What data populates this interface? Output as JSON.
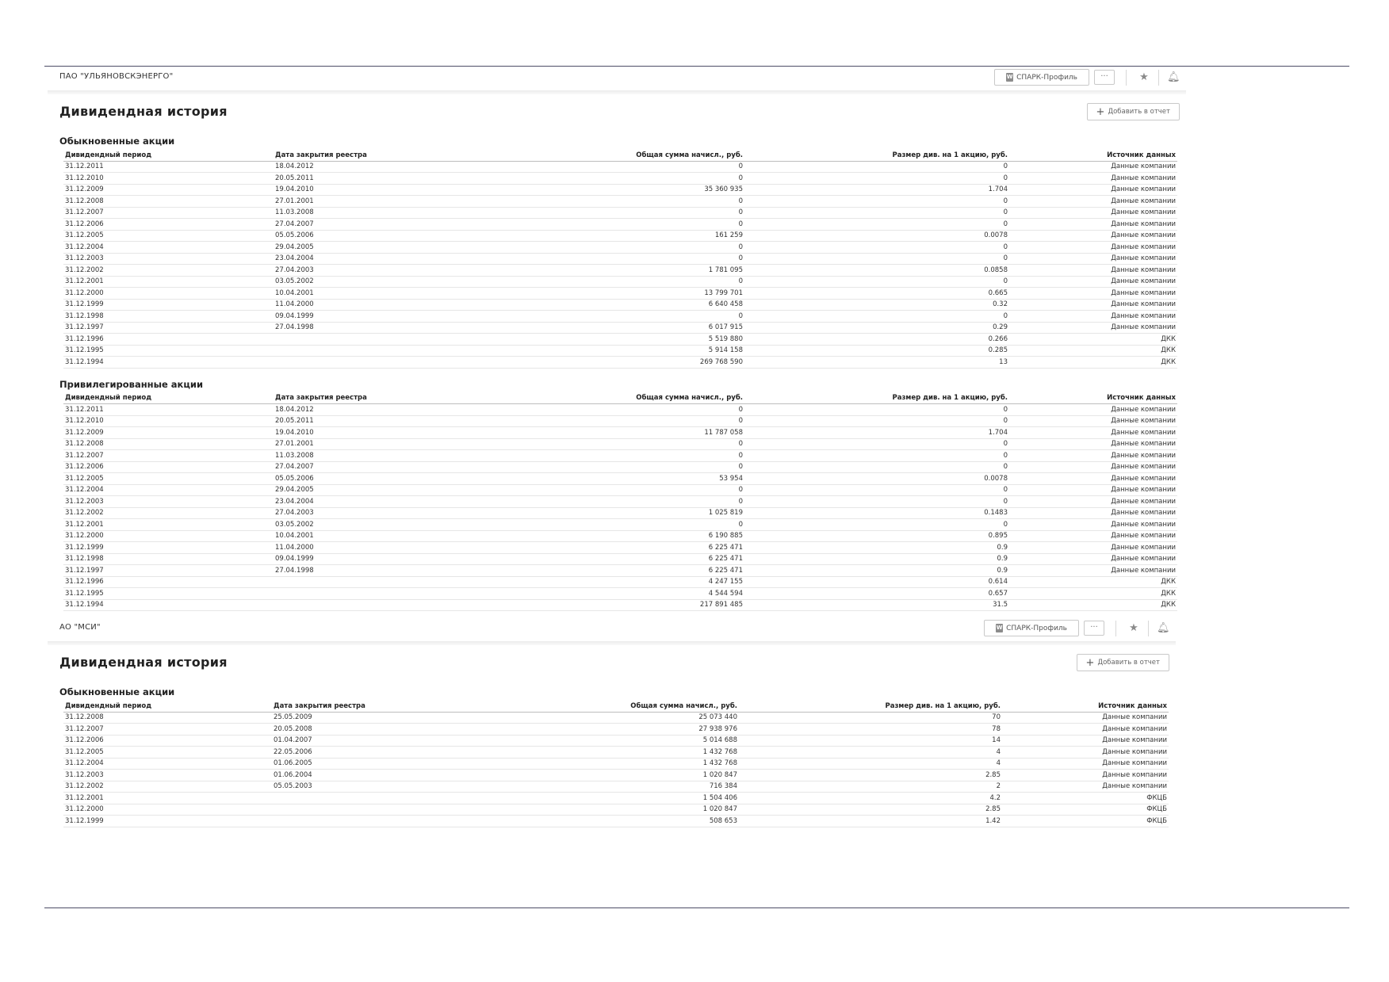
{
  "columns": {
    "period": "Дивидендный период",
    "record_date": "Дата закрытия реестра",
    "total": "Общая сумма начисл., руб.",
    "per_share": "Размер див. на 1 акцию, руб.",
    "source": "Источник данных"
  },
  "companies": [
    {
      "name": "ПАО \"УЛЬЯНОВСКЭНЕРГО\"",
      "spark_label": "СПАРК-Профиль",
      "more_label": "···",
      "section_title": "Дивидендная история",
      "add_label": "Добавить в отчет",
      "tables": [
        {
          "title": "Обыкновенные акции",
          "rows": [
            [
              "31.12.2011",
              "18.04.2012",
              "0",
              "0",
              "Данные компании"
            ],
            [
              "31.12.2010",
              "20.05.2011",
              "0",
              "0",
              "Данные компании"
            ],
            [
              "31.12.2009",
              "19.04.2010",
              "35 360 935",
              "1.704",
              "Данные компании"
            ],
            [
              "31.12.2008",
              "27.01.2001",
              "0",
              "0",
              "Данные компании"
            ],
            [
              "31.12.2007",
              "11.03.2008",
              "0",
              "0",
              "Данные компании"
            ],
            [
              "31.12.2006",
              "27.04.2007",
              "0",
              "0",
              "Данные компании"
            ],
            [
              "31.12.2005",
              "05.05.2006",
              "161 259",
              "0.0078",
              "Данные компании"
            ],
            [
              "31.12.2004",
              "29.04.2005",
              "0",
              "0",
              "Данные компании"
            ],
            [
              "31.12.2003",
              "23.04.2004",
              "0",
              "0",
              "Данные компании"
            ],
            [
              "31.12.2002",
              "27.04.2003",
              "1 781 095",
              "0.0858",
              "Данные компании"
            ],
            [
              "31.12.2001",
              "03.05.2002",
              "0",
              "0",
              "Данные компании"
            ],
            [
              "31.12.2000",
              "10.04.2001",
              "13 799 701",
              "0.665",
              "Данные компании"
            ],
            [
              "31.12.1999",
              "11.04.2000",
              "6 640 458",
              "0.32",
              "Данные компании"
            ],
            [
              "31.12.1998",
              "09.04.1999",
              "0",
              "0",
              "Данные компании"
            ],
            [
              "31.12.1997",
              "27.04.1998",
              "6 017 915",
              "0.29",
              "Данные компании"
            ],
            [
              "31.12.1996",
              "",
              "5 519 880",
              "0.266",
              "ДКК"
            ],
            [
              "31.12.1995",
              "",
              "5 914 158",
              "0.285",
              "ДКК"
            ],
            [
              "31.12.1994",
              "",
              "269 768 590",
              "13",
              "ДКК"
            ]
          ]
        },
        {
          "title": "Привилегированные акции",
          "rows": [
            [
              "31.12.2011",
              "18.04.2012",
              "0",
              "0",
              "Данные компании"
            ],
            [
              "31.12.2010",
              "20.05.2011",
              "0",
              "0",
              "Данные компании"
            ],
            [
              "31.12.2009",
              "19.04.2010",
              "11 787 058",
              "1.704",
              "Данные компании"
            ],
            [
              "31.12.2008",
              "27.01.2001",
              "0",
              "0",
              "Данные компании"
            ],
            [
              "31.12.2007",
              "11.03.2008",
              "0",
              "0",
              "Данные компании"
            ],
            [
              "31.12.2006",
              "27.04.2007",
              "0",
              "0",
              "Данные компании"
            ],
            [
              "31.12.2005",
              "05.05.2006",
              "53 954",
              "0.0078",
              "Данные компании"
            ],
            [
              "31.12.2004",
              "29.04.2005",
              "0",
              "0",
              "Данные компании"
            ],
            [
              "31.12.2003",
              "23.04.2004",
              "0",
              "0",
              "Данные компании"
            ],
            [
              "31.12.2002",
              "27.04.2003",
              "1 025 819",
              "0.1483",
              "Данные компании"
            ],
            [
              "31.12.2001",
              "03.05.2002",
              "0",
              "0",
              "Данные компании"
            ],
            [
              "31.12.2000",
              "10.04.2001",
              "6 190 885",
              "0.895",
              "Данные компании"
            ],
            [
              "31.12.1999",
              "11.04.2000",
              "6 225 471",
              "0.9",
              "Данные компании"
            ],
            [
              "31.12.1998",
              "09.04.1999",
              "6 225 471",
              "0.9",
              "Данные компании"
            ],
            [
              "31.12.1997",
              "27.04.1998",
              "6 225 471",
              "0.9",
              "Данные компании"
            ],
            [
              "31.12.1996",
              "",
              "4 247 155",
              "0.614",
              "ДКК"
            ],
            [
              "31.12.1995",
              "",
              "4 544 594",
              "0.657",
              "ДКК"
            ],
            [
              "31.12.1994",
              "",
              "217 891 485",
              "31.5",
              "ДКК"
            ]
          ]
        }
      ]
    },
    {
      "name": "АО \"МСИ\"",
      "spark_label": "СПАРК-Профиль",
      "more_label": "···",
      "section_title": "Дивидендная история",
      "add_label": "Добавить в отчет",
      "tables": [
        {
          "title": "Обыкновенные акции",
          "rows": [
            [
              "31.12.2008",
              "25.05.2009",
              "25 073 440",
              "70",
              "Данные компании"
            ],
            [
              "31.12.2007",
              "20.05.2008",
              "27 938 976",
              "78",
              "Данные компании"
            ],
            [
              "31.12.2006",
              "01.04.2007",
              "5 014 688",
              "14",
              "Данные компании"
            ],
            [
              "31.12.2005",
              "22.05.2006",
              "1 432 768",
              "4",
              "Данные компании"
            ],
            [
              "31.12.2004",
              "01.06.2005",
              "1 432 768",
              "4",
              "Данные компании"
            ],
            [
              "31.12.2003",
              "01.06.2004",
              "1 020 847",
              "2.85",
              "Данные компании"
            ],
            [
              "31.12.2002",
              "05.05.2003",
              "716 384",
              "2",
              "Данные компании"
            ],
            [
              "31.12.2001",
              "",
              "1 504 406",
              "4.2",
              "ФКЦБ"
            ],
            [
              "31.12.2000",
              "",
              "1 020 847",
              "2.85",
              "ФКЦБ"
            ],
            [
              "31.12.1999",
              "",
              "508 653",
              "1.42",
              "ФКЦБ"
            ]
          ]
        }
      ]
    }
  ]
}
